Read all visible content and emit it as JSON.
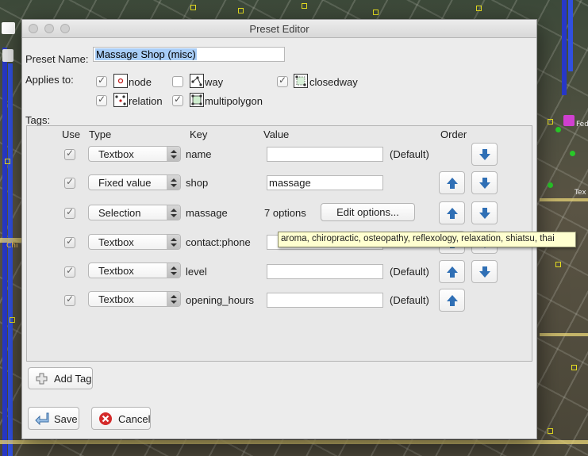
{
  "window": {
    "title": "Preset Editor"
  },
  "preset_name": {
    "label": "Preset Name:",
    "value": "Massage Shop (misc)"
  },
  "applies_to": {
    "label": "Applies to:",
    "items": [
      {
        "label": "node",
        "checked": true
      },
      {
        "label": "way",
        "checked": false
      },
      {
        "label": "closedway",
        "checked": true
      },
      {
        "label": "relation",
        "checked": true
      },
      {
        "label": "multipolygon",
        "checked": true
      }
    ]
  },
  "tags": {
    "label": "Tags:",
    "headers": {
      "use": "Use",
      "type": "Type",
      "key": "Key",
      "value": "Value",
      "order": "Order"
    },
    "rows": [
      {
        "use": true,
        "type": "Textbox",
        "key": "name",
        "value": "",
        "extra": "(Default)",
        "up": false,
        "down": true
      },
      {
        "use": true,
        "type": "Fixed value",
        "key": "shop",
        "value": "massage",
        "extra": "",
        "up": true,
        "down": true
      },
      {
        "use": true,
        "type": "Selection",
        "key": "massage",
        "value": "7 options",
        "extra": "Edit options...",
        "up": true,
        "down": true
      },
      {
        "use": true,
        "type": "Textbox",
        "key": "contact:phone",
        "value": "",
        "extra": "",
        "up": true,
        "down": true
      },
      {
        "use": true,
        "type": "Textbox",
        "key": "level",
        "value": "",
        "extra": "(Default)",
        "up": true,
        "down": true
      },
      {
        "use": true,
        "type": "Textbox",
        "key": "opening_hours",
        "value": "",
        "extra": "(Default)",
        "up": true,
        "down": false
      }
    ]
  },
  "tooltip": "aroma, chiropractic, osteopathy, reflexology, relaxation, shiatsu, thai",
  "buttons": {
    "add_tag": "Add Tag",
    "save": "Save",
    "cancel": "Cancel"
  },
  "map_labels": {
    "a": "Fed",
    "b": "Chi",
    "c": "Tex"
  },
  "colors": {
    "arrow_blue": "#2f6fb5",
    "tooltip_bg": "#ffffd0",
    "selection": "#a8cdf7",
    "cancel_red": "#d42a2a"
  }
}
